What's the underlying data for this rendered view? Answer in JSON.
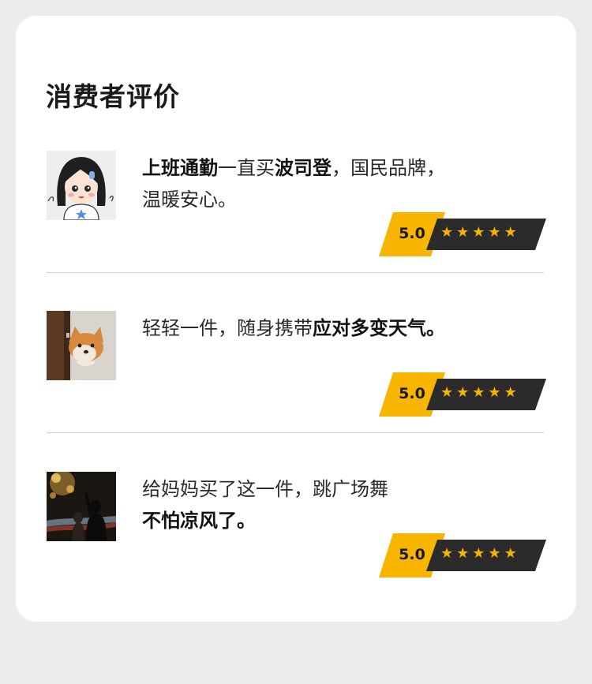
{
  "section": {
    "title": "消费者评价"
  },
  "reviews": [
    {
      "avatar_icon": "cartoon-girl-avatar",
      "segments": [
        {
          "text": "上班通勤",
          "bold": true
        },
        {
          "text": "一直买",
          "bold": false
        },
        {
          "text": "波司登",
          "bold": true
        },
        {
          "text": "，国民品牌，",
          "bold": false
        },
        {
          "br": true
        },
        {
          "text": "温暖安心。",
          "bold": false
        }
      ],
      "score": "5.0",
      "stars": 5
    },
    {
      "avatar_icon": "shiba-dog-photo",
      "segments": [
        {
          "text": "轻轻一件，随身携带",
          "bold": false
        },
        {
          "text": "应对多变天气。",
          "bold": true
        }
      ],
      "score": "5.0",
      "stars": 5
    },
    {
      "avatar_icon": "night-street-photo",
      "segments": [
        {
          "text": "给妈妈买了这一件，跳广场舞",
          "bold": false
        },
        {
          "br": true
        },
        {
          "text": "不怕凉风了。",
          "bold": true
        }
      ],
      "score": "5.0",
      "stars": 5
    }
  ],
  "colors": {
    "rating_yellow": "#f7b500",
    "rating_dark": "#2b2b2b",
    "star": "#f7b500"
  }
}
